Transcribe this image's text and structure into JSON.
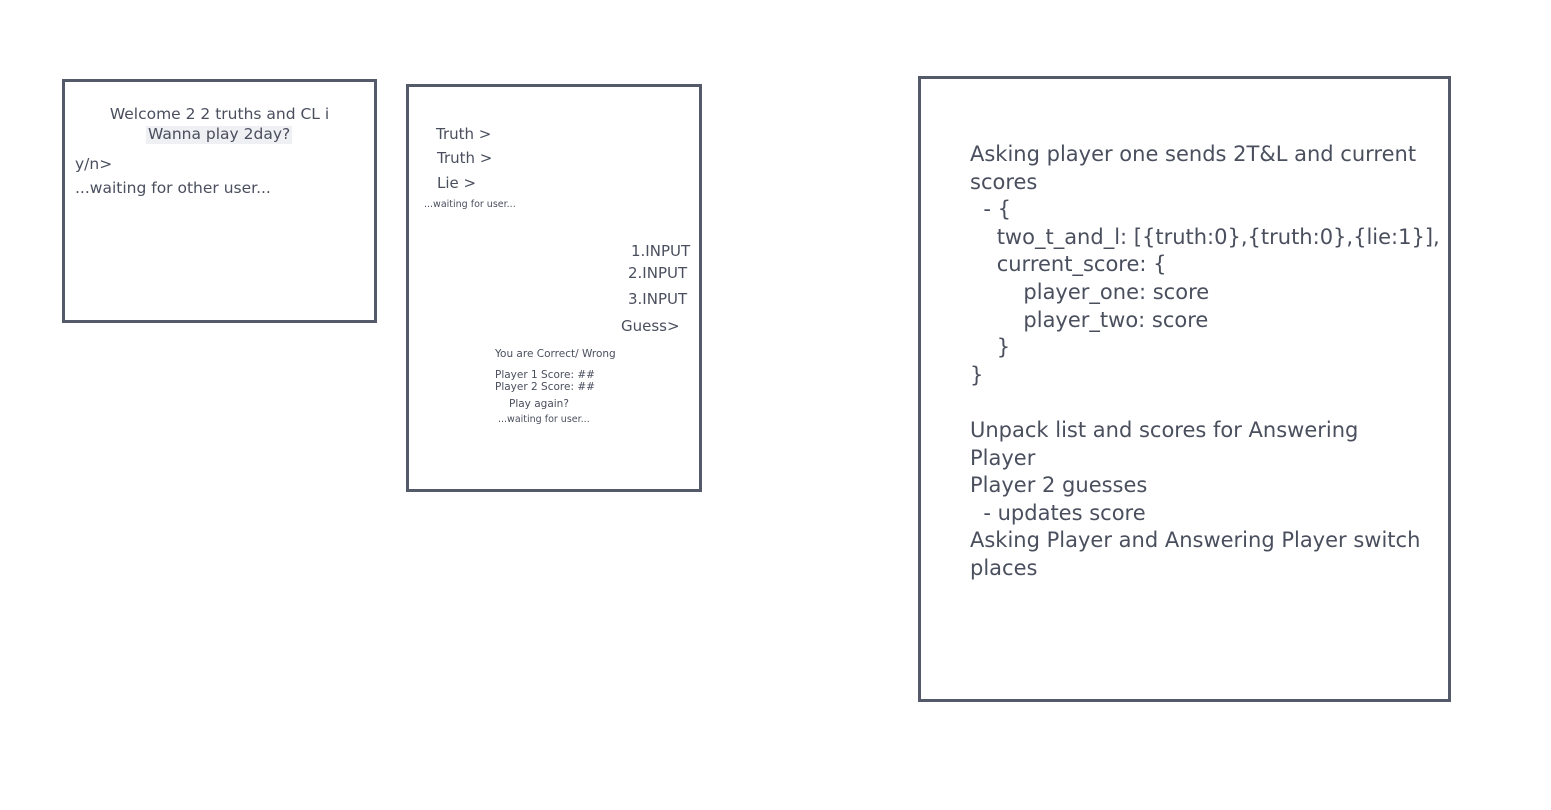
{
  "welcome_screen": {
    "title": "Welcome 2 2 truths and CL i",
    "prompt": "Wanna play 2day?",
    "input_prompt": "y/n>",
    "waiting": "...waiting for other user..."
  },
  "game_screen": {
    "entries": [
      {
        "label": "Truth >"
      },
      {
        "label": "Truth >"
      },
      {
        "label": "Lie >"
      }
    ],
    "waiting_1": "...waiting for user...",
    "inputs": [
      "1.INPUT",
      "2.INPUT",
      "3.INPUT"
    ],
    "guess_prompt": "Guess>",
    "result": "You are Correct/ Wrong",
    "player1_score": "Player 1 Score: ##",
    "player2_score": "Player 2 Score: ##",
    "play_again": "Play again?",
    "waiting_2": "...waiting for user..."
  },
  "notes": {
    "text": "Asking player one sends 2T&L and current\nscores\n  - {\n    two_t_and_l: [{truth:0},{truth:0},{lie:1}],\n    current_score: {\n        player_one: score\n        player_two: score\n    }\n}\n\nUnpack list and scores for Answering\nPlayer\nPlayer 2 guesses\n  - updates score\nAsking Player and Answering Player switch\nplaces"
  }
}
